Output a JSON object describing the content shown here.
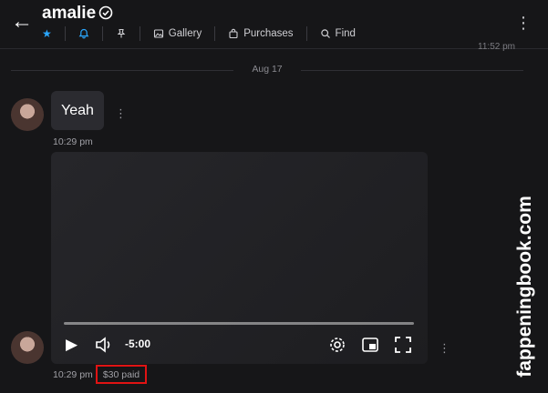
{
  "header": {
    "back_icon": "arrow-left-icon",
    "title": "amalie",
    "verified_icon": "verified-check-icon",
    "more_icon": "more-vertical-icon"
  },
  "toolbar": {
    "star_icon": "star-icon",
    "bell_icon": "bell-icon",
    "pin_icon": "pin-icon",
    "gallery_label": "Gallery",
    "purchases_label": "Purchases",
    "find_label": "Find"
  },
  "colors": {
    "accent": "#2aa7ff",
    "highlight_box": "#e01313",
    "background": "#161618"
  },
  "previous_message_time": "11:52 pm",
  "date_separator": "Aug 17",
  "messages": [
    {
      "text": "Yeah",
      "time": "10:29 pm"
    },
    {
      "type": "video",
      "time": "10:29 pm",
      "price_status": "$30 paid",
      "player": {
        "duration": "-5:00",
        "progress": 0
      }
    }
  ],
  "watermark": "fappeningbook.com"
}
